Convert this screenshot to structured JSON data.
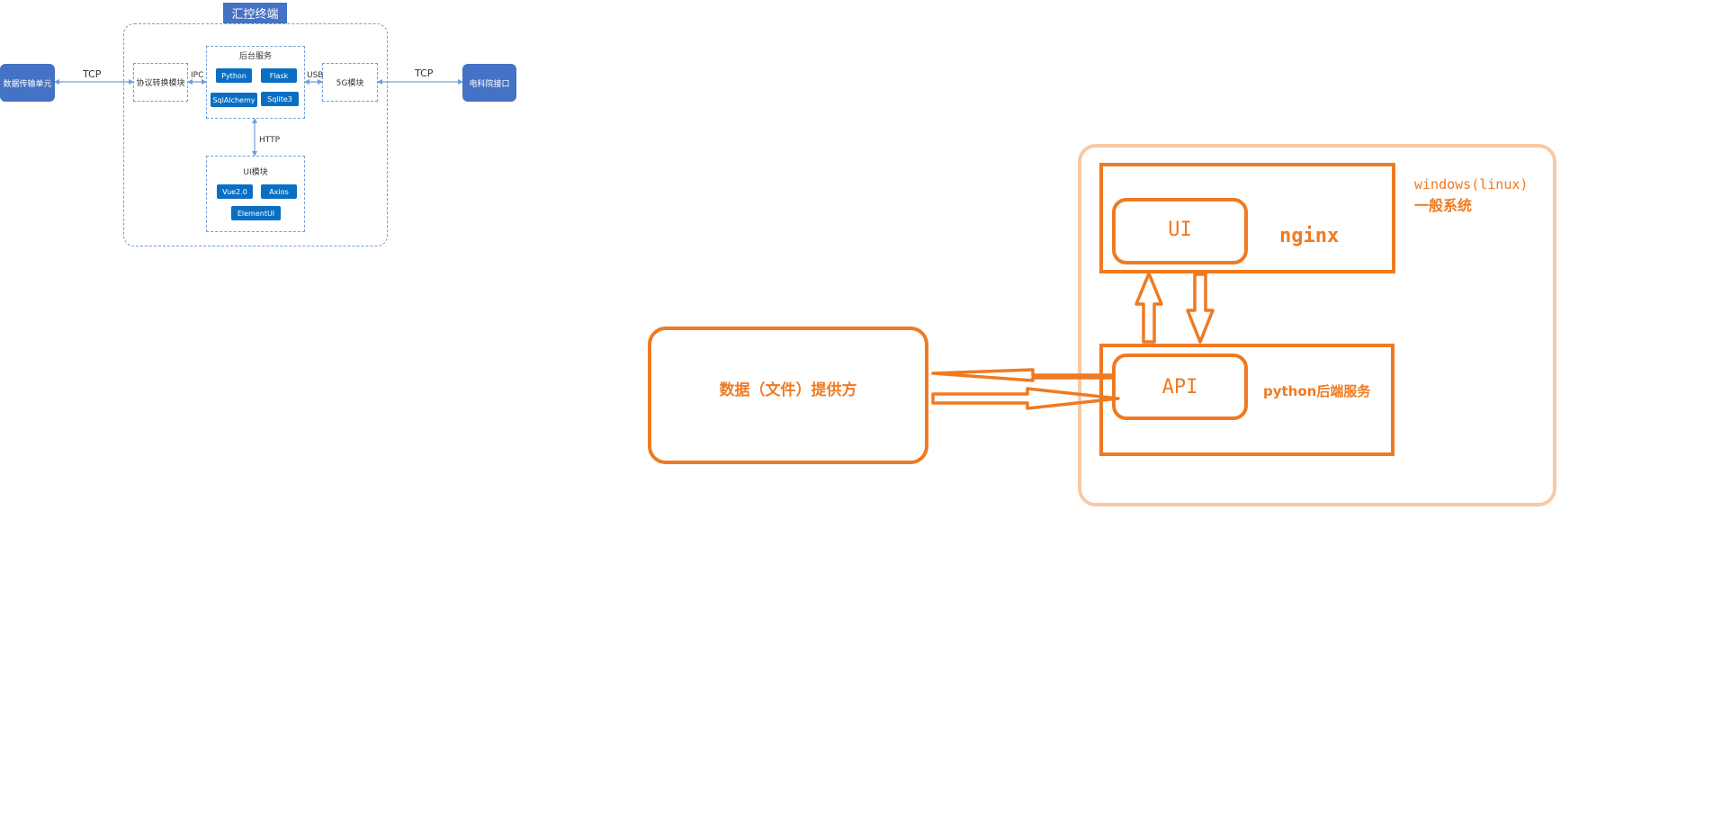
{
  "left": {
    "title": "汇控终端",
    "nodes": {
      "data_unit": "数据传输单元",
      "grid_api": "电科院接口",
      "protocol_module": "协议转换模块",
      "backend_title": "后台服务",
      "module_5g": "5G模块",
      "ui_module_title": "UI模块"
    },
    "chips": {
      "python": "Python",
      "flask": "Flask",
      "sqlalchemy": "SqlAlchemy",
      "sqlite3": "Sqlite3",
      "vue": "Vue2.0",
      "axios": "Axios",
      "elementui": "ElementUI"
    },
    "edges": {
      "tcp_left": "TCP",
      "ipc": "IPC",
      "usb": "USB",
      "tcp_right": "TCP",
      "http": "HTTP"
    },
    "colors": {
      "node": "#4472c4",
      "chip": "#0a6fc2",
      "dash": "#6f9fd8"
    }
  },
  "right": {
    "system_label_line1": "windows(linux)",
    "system_label_line2": "一般系统",
    "ui": "UI",
    "nginx": "nginx",
    "api": "API",
    "backend_label": "python后端服务",
    "provider": "数据（文件）提供方",
    "colors": {
      "orange": "#ef7a22",
      "outer": "#f9c9a3"
    }
  }
}
